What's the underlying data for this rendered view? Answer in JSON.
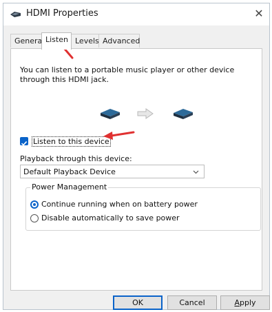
{
  "window": {
    "title": "HDMI Properties",
    "close_glyph": "✕"
  },
  "tabs": [
    {
      "label": "General",
      "active": false
    },
    {
      "label": "Listen",
      "active": true
    },
    {
      "label": "Levels",
      "active": false
    },
    {
      "label": "Advanced",
      "active": false
    }
  ],
  "listen": {
    "description": "You can listen to a portable music player or other device through this HDMI jack.",
    "checkbox_label": "Listen to this device",
    "checkbox_checked": true,
    "playback_label": "Playback through this device:",
    "playback_value": "Default Playback Device"
  },
  "power": {
    "title": "Power Management",
    "options": [
      {
        "label": "Continue running when on battery power",
        "selected": true
      },
      {
        "label": "Disable automatically to save power",
        "selected": false
      }
    ]
  },
  "buttons": {
    "ok": "OK",
    "cancel": "Cancel",
    "apply_first": "A",
    "apply_rest": "pply"
  },
  "icons": [
    "hdmi-device-icon",
    "arrow-right-icon",
    "chevron-down-icon",
    "checkmark-icon"
  ],
  "colors": {
    "accent": "#0a63c9",
    "annotation": "#e03131"
  }
}
